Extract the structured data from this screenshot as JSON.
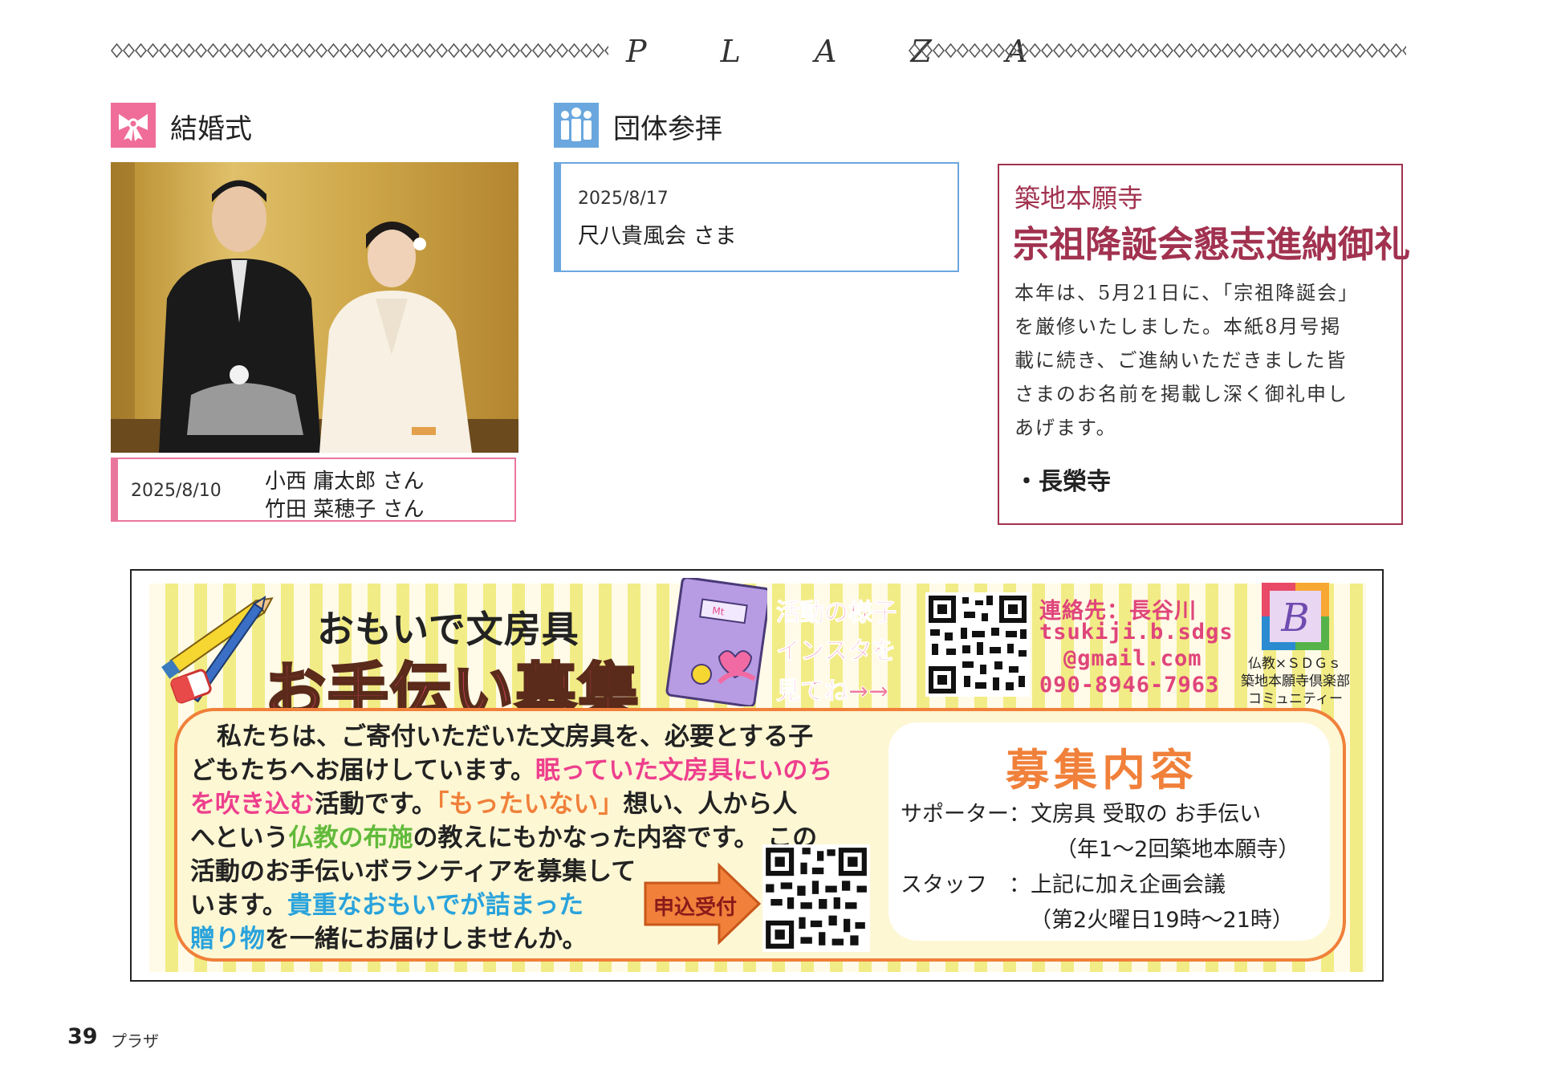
{
  "header": {
    "title": "P L A Z A"
  },
  "wedding": {
    "section_title": "結婚式",
    "date": "2025/8/10",
    "groom": "小西 庸太郎 さん",
    "bride": "竹田 菜穂子 さん"
  },
  "group": {
    "section_title": "団体参拝",
    "date": "2025/8/17",
    "name": "尺八貴風会 さま"
  },
  "notice": {
    "subtitle": "築地本願寺",
    "title": "宗祖降誕会懇志進納御礼",
    "body_lines": [
      "本年は、5月21日に、「宗祖降誕会」",
      "を厳修いたしました。本紙8月号掲",
      "載に続き、ご進納いただきました皆",
      "さまのお名前を掲載し深く御礼申し",
      "あげます。"
    ],
    "item": "・長榮寺"
  },
  "ad": {
    "title1": "おもいで文房具",
    "title2": "お手伝い募集",
    "insta_lines": [
      "活動の様子",
      "インスタを",
      "見てね→→"
    ],
    "contact_lines": [
      "連絡先：長谷川",
      "tsukiji.b.sdgs",
      "@gmail.com",
      "090-8946-7963"
    ],
    "club_lines": [
      "仏教×ＳＤＧｓ",
      "築地本願寺倶楽部",
      "コミュニティー"
    ],
    "logo_letter": "B",
    "notebook_text": "Mt",
    "body": {
      "l1": "私たちは、ご寄付いただいた文房具を、必要とする子",
      "l2a": "どもたちへお届けしています。",
      "l2b": "眠っていた文房具にいのち",
      "l3a": "を吹き込む",
      "l3b": "活動です。",
      "l3c": "「もったいない」",
      "l3d": "想い、人から人",
      "l4a": "へという",
      "l4b": "仏教の布施",
      "l4c": "の教えにもかなった内容です。 この",
      "l5": "活動のお手伝いボランティアを募集して",
      "l6a": "います。",
      "l6b": "貴重なおもいでが詰まった",
      "l7a": "贈り物",
      "l7b": "を一緒にお届けしませんか。"
    },
    "apply_label": "申込受付",
    "recruit": {
      "title": "募集内容",
      "supporter": "サポーター：文房具 受取の お手伝い",
      "supporter_sub": "（年1～2回築地本願寺）",
      "staff": "スタッフ　：上記に加え企画会議",
      "staff_sub": "（第2火曜日19時～21時）"
    }
  },
  "footer": {
    "page_number": "39",
    "label": "プラザ"
  },
  "colors": {
    "wedding": "#e9769d",
    "group": "#6aa7de",
    "notice": "#a1324f",
    "ad_accent": "#f0803a"
  }
}
